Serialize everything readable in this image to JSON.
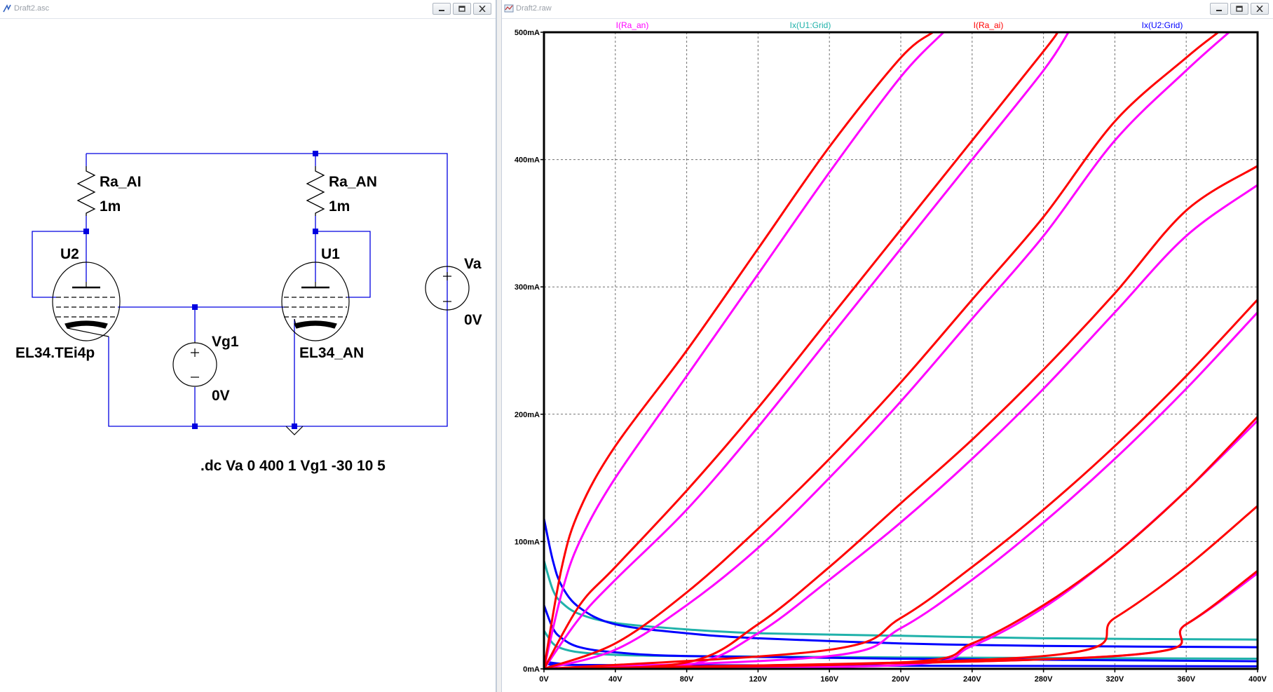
{
  "schematic": {
    "title": "Draft2.asc",
    "labels": {
      "ra_ai": "Ra_AI",
      "ra_ai_value": "1m",
      "ra_an": "Ra_AN",
      "ra_an_value": "1m",
      "u2": "U2",
      "u1": "U1",
      "u2_model": "EL34.TEi4p",
      "u1_model": "EL34_AN",
      "vg1": "Vg1",
      "vg1_value": "0V",
      "va": "Va",
      "va_value": "0V"
    },
    "directive": ".dc Va 0 400 1 Vg1 -30 10 5"
  },
  "plot": {
    "title": "Draft2.raw",
    "traces": [
      {
        "label": "I(Ra_an)",
        "color": "#ff00ff"
      },
      {
        "label": "Ix(U1:Grid)",
        "color": "#20b2aa"
      },
      {
        "label": "I(Ra_ai)",
        "color": "#ff0000"
      },
      {
        "label": "Ix(U2:Grid)",
        "color": "#0000ff"
      }
    ],
    "yticks": [
      "0mA",
      "100mA",
      "200mA",
      "300mA",
      "400mA",
      "500mA"
    ],
    "xticks": [
      "0V",
      "40V",
      "80V",
      "120V",
      "160V",
      "200V",
      "240V",
      "280V",
      "320V",
      "360V",
      "400V"
    ]
  },
  "chart_data": {
    "type": "line",
    "xlabel": "",
    "ylabel": "",
    "xlim": [
      0,
      400
    ],
    "ylim": [
      0,
      500
    ],
    "x_unit": "V",
    "y_unit": "mA",
    "grid": true,
    "legend": "top",
    "series": [
      {
        "name": "I(Ra_ai)",
        "color": "#ff0000",
        "curves": [
          [
            [
              0,
              0
            ],
            [
              10,
              80
            ],
            [
              20,
              125
            ],
            [
              40,
              175
            ],
            [
              80,
              250
            ],
            [
              120,
              330
            ],
            [
              160,
              410
            ],
            [
              200,
              480
            ],
            [
              218,
              500
            ]
          ],
          [
            [
              0,
              0
            ],
            [
              20,
              50
            ],
            [
              40,
              80
            ],
            [
              80,
              140
            ],
            [
              120,
              205
            ],
            [
              160,
              275
            ],
            [
              200,
              345
            ],
            [
              240,
              415
            ],
            [
              280,
              485
            ],
            [
              288,
              500
            ]
          ],
          [
            [
              0,
              0
            ],
            [
              40,
              20
            ],
            [
              80,
              60
            ],
            [
              120,
              110
            ],
            [
              160,
              165
            ],
            [
              200,
              225
            ],
            [
              240,
              290
            ],
            [
              280,
              355
            ],
            [
              320,
              430
            ],
            [
              360,
              480
            ],
            [
              378,
              500
            ]
          ],
          [
            [
              0,
              0
            ],
            [
              80,
              5
            ],
            [
              120,
              35
            ],
            [
              160,
              80
            ],
            [
              200,
              130
            ],
            [
              240,
              180
            ],
            [
              280,
              235
            ],
            [
              320,
              295
            ],
            [
              360,
              360
            ],
            [
              400,
              395
            ]
          ],
          [
            [
              0,
              0
            ],
            [
              160,
              15
            ],
            [
              200,
              40
            ],
            [
              240,
              80
            ],
            [
              280,
              125
            ],
            [
              320,
              175
            ],
            [
              360,
              230
            ],
            [
              400,
              290
            ]
          ],
          [
            [
              0,
              0
            ],
            [
              200,
              5
            ],
            [
              240,
              20
            ],
            [
              280,
              50
            ],
            [
              320,
              90
            ],
            [
              360,
              140
            ],
            [
              400,
              198
            ]
          ],
          [
            [
              0,
              0
            ],
            [
              280,
              10
            ],
            [
              320,
              40
            ],
            [
              360,
              80
            ],
            [
              400,
              128
            ]
          ],
          [
            [
              0,
              0
            ],
            [
              320,
              10
            ],
            [
              360,
              35
            ],
            [
              400,
              77
            ]
          ]
        ]
      },
      {
        "name": "I(Ra_an)",
        "color": "#ff00ff",
        "curves": [
          [
            [
              0,
              0
            ],
            [
              10,
              60
            ],
            [
              20,
              100
            ],
            [
              40,
              150
            ],
            [
              80,
              230
            ],
            [
              120,
              310
            ],
            [
              160,
              390
            ],
            [
              200,
              465
            ],
            [
              224,
              500
            ]
          ],
          [
            [
              0,
              0
            ],
            [
              20,
              40
            ],
            [
              40,
              70
            ],
            [
              80,
              125
            ],
            [
              120,
              190
            ],
            [
              160,
              260
            ],
            [
              200,
              330
            ],
            [
              240,
              400
            ],
            [
              280,
              470
            ],
            [
              294,
              500
            ]
          ],
          [
            [
              0,
              0
            ],
            [
              40,
              15
            ],
            [
              80,
              50
            ],
            [
              120,
              95
            ],
            [
              160,
              150
            ],
            [
              200,
              210
            ],
            [
              240,
              275
            ],
            [
              280,
              340
            ],
            [
              320,
              415
            ],
            [
              360,
              470
            ],
            [
              384,
              500
            ]
          ],
          [
            [
              0,
              0
            ],
            [
              80,
              3
            ],
            [
              120,
              28
            ],
            [
              160,
              70
            ],
            [
              200,
              115
            ],
            [
              240,
              165
            ],
            [
              280,
              220
            ],
            [
              320,
              280
            ],
            [
              360,
              340
            ],
            [
              400,
              380
            ]
          ],
          [
            [
              0,
              0
            ],
            [
              160,
              10
            ],
            [
              200,
              32
            ],
            [
              240,
              70
            ],
            [
              280,
              115
            ],
            [
              320,
              165
            ],
            [
              360,
              220
            ],
            [
              400,
              280
            ]
          ],
          [
            [
              0,
              0
            ],
            [
              200,
              3
            ],
            [
              240,
              18
            ],
            [
              280,
              48
            ],
            [
              320,
              90
            ],
            [
              360,
              140
            ],
            [
              400,
              195
            ]
          ],
          [
            [
              0,
              0
            ],
            [
              320,
              10
            ],
            [
              360,
              35
            ],
            [
              400,
              75
            ]
          ]
        ]
      },
      {
        "name": "Ix(U1:Grid)",
        "color": "#20b2aa",
        "curves": [
          [
            [
              0,
              85
            ],
            [
              5,
              62
            ],
            [
              10,
              52
            ],
            [
              20,
              43
            ],
            [
              40,
              36
            ],
            [
              80,
              31
            ],
            [
              120,
              28
            ],
            [
              200,
              26
            ],
            [
              280,
              24
            ],
            [
              400,
              23
            ]
          ],
          [
            [
              0,
              30
            ],
            [
              5,
              20
            ],
            [
              10,
              16
            ],
            [
              20,
              13
            ],
            [
              40,
              11
            ],
            [
              80,
              10
            ],
            [
              200,
              9
            ],
            [
              400,
              8
            ]
          ]
        ]
      },
      {
        "name": "Ix(U2:Grid)",
        "color": "#0000ff",
        "curves": [
          [
            [
              0,
              118
            ],
            [
              5,
              85
            ],
            [
              10,
              65
            ],
            [
              20,
              48
            ],
            [
              40,
              35
            ],
            [
              80,
              28
            ],
            [
              120,
              24
            ],
            [
              200,
              20
            ],
            [
              280,
              18
            ],
            [
              400,
              17
            ]
          ],
          [
            [
              0,
              50
            ],
            [
              5,
              32
            ],
            [
              10,
              24
            ],
            [
              20,
              17
            ],
            [
              40,
              13
            ],
            [
              80,
              10
            ],
            [
              200,
              8
            ],
            [
              400,
              6
            ]
          ],
          [
            [
              0,
              6
            ],
            [
              10,
              4
            ],
            [
              40,
              3
            ],
            [
              400,
              2
            ]
          ]
        ]
      }
    ]
  }
}
